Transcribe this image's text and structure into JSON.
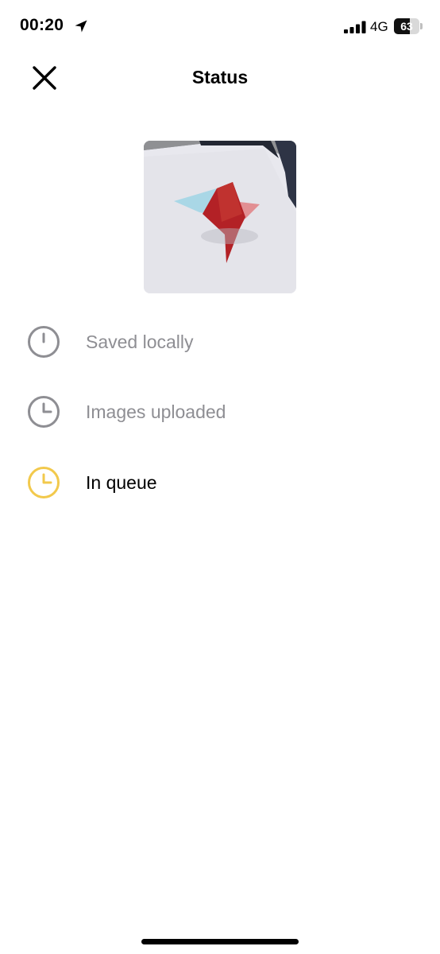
{
  "status_bar": {
    "time": "00:20",
    "network": "4G",
    "battery_level": "63",
    "battery_fraction": 0.63,
    "icons": [
      "location-arrow-icon",
      "signal-bars-icon",
      "battery-icon"
    ]
  },
  "header": {
    "title": "Status",
    "close_icon": "close-icon"
  },
  "thumbnail": {
    "description_icon": "photo-thumbnail"
  },
  "steps": [
    {
      "label": "Saved locally",
      "state": "done",
      "icon": "clock-icon"
    },
    {
      "label": "Images uploaded",
      "state": "done",
      "icon": "clock-icon"
    },
    {
      "label": "In queue",
      "state": "active",
      "icon": "clock-icon"
    }
  ],
  "colors": {
    "muted": "#8e8e93",
    "active": "#f2c94c",
    "text": "#000000",
    "background": "#ffffff"
  }
}
